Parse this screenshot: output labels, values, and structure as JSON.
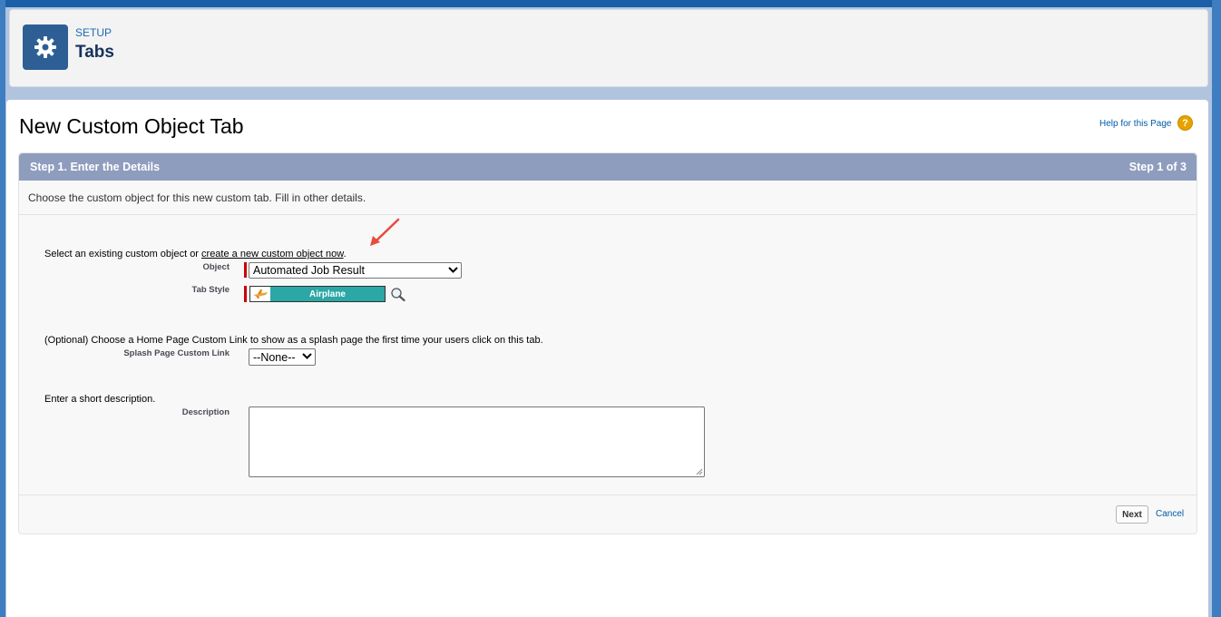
{
  "header": {
    "icon": "gear-icon",
    "eyebrow": "SETUP",
    "title": "Tabs"
  },
  "page": {
    "title": "New Custom Object Tab",
    "help_link": "Help for this Page",
    "help_icon": "question-icon"
  },
  "section": {
    "title": "Step 1. Enter the Details",
    "step": "Step 1 of 3",
    "intro": "Choose the custom object for this new custom tab. Fill in other details."
  },
  "object_select": {
    "prompt_prefix": "Select an existing custom object or ",
    "prompt_link": "create a new custom object now",
    "prompt_suffix": ".",
    "label": "Object",
    "value": "Automated Job Result"
  },
  "tab_style": {
    "label": "Tab Style",
    "value": "Airplane",
    "icon": "airplane-icon",
    "lookup_icon": "magnifier-icon"
  },
  "splash": {
    "prompt": "(Optional) Choose a Home Page Custom Link to show as a splash page the first time your users click on this tab.",
    "label": "Splash Page Custom Link",
    "value": "--None--"
  },
  "description": {
    "prompt": "Enter a short description.",
    "label": "Description",
    "value": ""
  },
  "buttons": {
    "next": "Next",
    "cancel": "Cancel"
  },
  "colors": {
    "section_header": "#8e9dbd",
    "tab_style_swatch": "#2ba7a5",
    "header_icon_bg": "#2d5f94",
    "required": "#cc0000"
  }
}
